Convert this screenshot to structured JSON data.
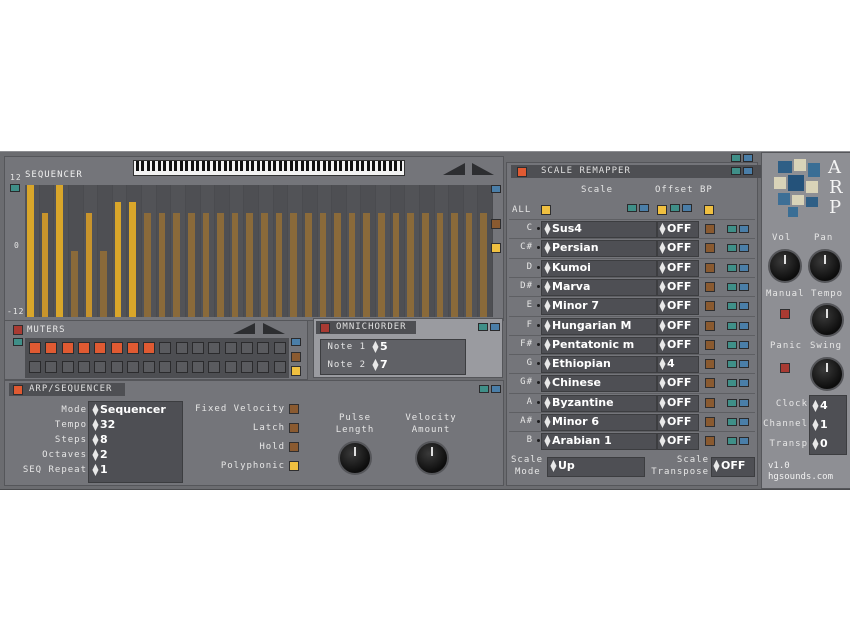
{
  "sequencer": {
    "title": "SEQUENCER",
    "scale_top": "12",
    "scale_mid": "0",
    "scale_bottom": "-12",
    "bars": [
      {
        "value": 12,
        "color": "#d9a62a"
      },
      {
        "value": 7,
        "color": "#c8942c"
      },
      {
        "value": 12,
        "color": "#d9a62a"
      },
      {
        "value": 0,
        "color": "#8a6a3a"
      },
      {
        "value": 7,
        "color": "#c8942c"
      },
      {
        "value": 0,
        "color": "#8a6a3a"
      },
      {
        "value": 9,
        "color": "#d9a62a"
      },
      {
        "value": 9,
        "color": "#d9a62a"
      },
      {
        "value": 7,
        "color": "#8a6a3a"
      },
      {
        "value": 7,
        "color": "#8a6a3a"
      },
      {
        "value": 7,
        "color": "#8a6a3a"
      },
      {
        "value": 7,
        "color": "#8a6a3a"
      },
      {
        "value": 7,
        "color": "#8a6a3a"
      },
      {
        "value": 7,
        "color": "#8a6a3a"
      },
      {
        "value": 7,
        "color": "#8a6a3a"
      },
      {
        "value": 7,
        "color": "#8a6a3a"
      },
      {
        "value": 7,
        "color": "#8a6a3a"
      },
      {
        "value": 7,
        "color": "#8a6a3a"
      },
      {
        "value": 7,
        "color": "#8a6a3a"
      },
      {
        "value": 7,
        "color": "#8a6a3a"
      },
      {
        "value": 7,
        "color": "#8a6a3a"
      },
      {
        "value": 7,
        "color": "#8a6a3a"
      },
      {
        "value": 7,
        "color": "#8a6a3a"
      },
      {
        "value": 7,
        "color": "#8a6a3a"
      },
      {
        "value": 7,
        "color": "#8a6a3a"
      },
      {
        "value": 7,
        "color": "#8a6a3a"
      },
      {
        "value": 7,
        "color": "#8a6a3a"
      },
      {
        "value": 7,
        "color": "#8a6a3a"
      },
      {
        "value": 7,
        "color": "#8a6a3a"
      },
      {
        "value": 7,
        "color": "#8a6a3a"
      },
      {
        "value": 7,
        "color": "#8a6a3a"
      },
      {
        "value": 7,
        "color": "#8a6a3a"
      }
    ]
  },
  "mutes": {
    "title": "MUTERS",
    "states": [
      1,
      1,
      1,
      1,
      1,
      1,
      1,
      1,
      0,
      0,
      0,
      0,
      0,
      0,
      0,
      0,
      0,
      0,
      0,
      0,
      0,
      0,
      0,
      0,
      0,
      0,
      0,
      0,
      0,
      0,
      0,
      0
    ]
  },
  "omnichorder": {
    "title": "OMNICHORDER",
    "note1_label": "Note 1",
    "note1_value": "5",
    "note2_label": "Note 2",
    "note2_value": "7"
  },
  "arp": {
    "title": "ARP/SEQUENCER",
    "mode_label": "Mode",
    "mode_value": "Sequencer",
    "tempo_label": "Tempo",
    "tempo_value": "32",
    "steps_label": "Steps",
    "steps_value": "8",
    "octaves_label": "Octaves",
    "octaves_value": "2",
    "seq_repeat_label": "SEQ Repeat",
    "seq_repeat_value": "1",
    "fixed_velocity_label": "Fixed Velocity",
    "latch_label": "Latch",
    "hold_label": "Hold",
    "polyphonic_label": "Polyphonic",
    "pulse_length_label_1": "Pulse",
    "pulse_length_label_2": "Length",
    "velocity_amount_label_1": "Velocity",
    "velocity_amount_label_2": "Amount"
  },
  "scale_remapper": {
    "title": "SCALE REMAPPER",
    "col_scale": "Scale",
    "col_offset": "Offset",
    "col_bp": "BP",
    "all_label": "ALL",
    "rows": [
      {
        "note": "C",
        "scale": "Sus4",
        "offset": "OFF"
      },
      {
        "note": "C#",
        "scale": "Persian",
        "offset": "OFF"
      },
      {
        "note": "D",
        "scale": "Kumoi",
        "offset": "OFF"
      },
      {
        "note": "D#",
        "scale": "Marva",
        "offset": "OFF"
      },
      {
        "note": "E",
        "scale": "Minor 7",
        "offset": "OFF"
      },
      {
        "note": "F",
        "scale": "Hungarian M",
        "offset": "OFF"
      },
      {
        "note": "F#",
        "scale": "Pentatonic m",
        "offset": "OFF"
      },
      {
        "note": "G",
        "scale": "Ethiopian",
        "offset": "4"
      },
      {
        "note": "G#",
        "scale": "Chinese",
        "offset": "OFF"
      },
      {
        "note": "A",
        "scale": "Byzantine",
        "offset": "OFF"
      },
      {
        "note": "A#",
        "scale": "Minor 6",
        "offset": "OFF"
      },
      {
        "note": "B",
        "scale": "Arabian 1",
        "offset": "OFF"
      }
    ],
    "scale_mode_label_1": "Scale",
    "scale_mode_label_2": "Mode",
    "scale_mode_value": "Up",
    "scale_transpose_label_1": "Scale",
    "scale_transpose_label_2": "Transpose",
    "scale_transpose_value": "OFF"
  },
  "side": {
    "logo_letters": [
      "A",
      "R",
      "P"
    ],
    "vol_label": "Vol",
    "pan_label": "Pan",
    "manual_label": "Manual",
    "tempo_label": "Tempo",
    "panic_label": "Panic",
    "swing_label": "Swing",
    "clock_label": "Clock",
    "clock_value": "4",
    "channel_label": "Channel",
    "channel_value": "1",
    "transp_label": "Transp",
    "transp_value": "0",
    "version": "v1.0",
    "website": "hgsounds.com"
  },
  "colors": {
    "bar_active": "#d9a62a",
    "bar_inactive": "#8a6a3a",
    "mute_on": "#e05a32",
    "mute_off": "#5a5b5f"
  }
}
